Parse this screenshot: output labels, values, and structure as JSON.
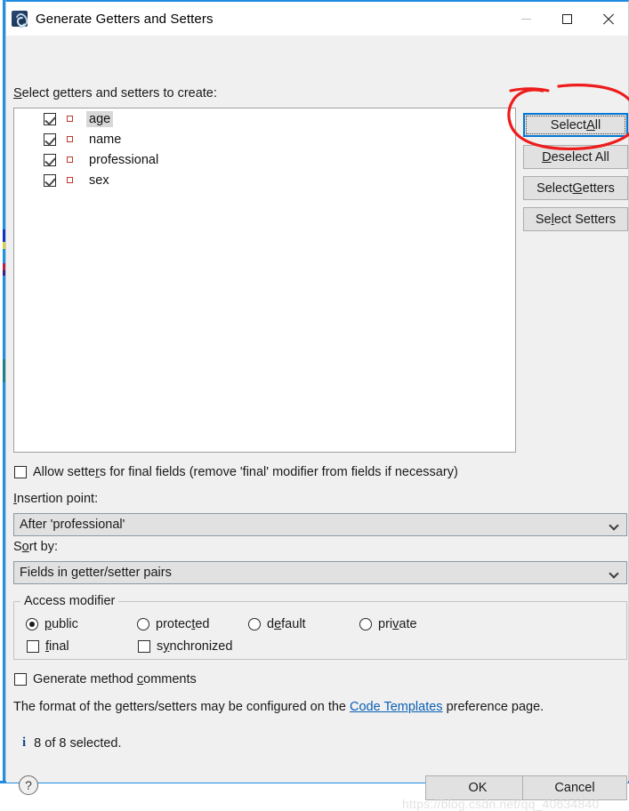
{
  "window": {
    "title": "Generate Getters and Setters",
    "icon": "eclipse-icon",
    "minimize_label": "—",
    "maximize_label": "□",
    "close_label": "✕"
  },
  "main": {
    "select_label_pre": "S",
    "select_label_post": "elect getters and setters to create:",
    "tree": {
      "items": [
        {
          "label": "age",
          "checked": true,
          "selected": true
        },
        {
          "label": "name",
          "checked": true,
          "selected": false
        },
        {
          "label": "professional",
          "checked": true,
          "selected": false
        },
        {
          "label": "sex",
          "checked": true,
          "selected": false
        }
      ]
    },
    "side_buttons": [
      {
        "pre": "Select ",
        "mnem": "A",
        "post": "ll",
        "focused": true
      },
      {
        "pre": "",
        "mnem": "D",
        "post": "eselect All",
        "focused": false
      },
      {
        "pre": "Select ",
        "mnem": "G",
        "post": "etters",
        "focused": false
      },
      {
        "pre": "Se",
        "mnem": "l",
        "post": "ect Setters",
        "focused": false
      }
    ],
    "allow_final": {
      "checked": false,
      "pre": "Allow sette",
      "mnem": "r",
      "post": "s for final fields (remove 'final' modifier from fields if necessary)"
    },
    "insertion": {
      "label_mnem": "I",
      "label_post": "nsertion point:",
      "value": "After 'professional'"
    },
    "sort": {
      "label_pre": "S",
      "label_mnem": "o",
      "label_post": "rt by:",
      "value": "Fields in getter/setter pairs"
    },
    "access_modifier": {
      "legend": "Access modifier",
      "radios": [
        {
          "pre": "",
          "mnem": "p",
          "post": "ublic",
          "selected": true
        },
        {
          "pre": "protec",
          "mnem": "t",
          "post": "ed",
          "selected": false
        },
        {
          "pre": "d",
          "mnem": "e",
          "post": "fault",
          "selected": false
        },
        {
          "pre": "pri",
          "mnem": "v",
          "post": "ate",
          "selected": false
        }
      ],
      "checkboxes": [
        {
          "pre": "",
          "mnem": "f",
          "post": "inal",
          "checked": false
        },
        {
          "pre": "s",
          "mnem": "y",
          "post": "nchronized",
          "checked": false
        }
      ]
    },
    "generate_comments": {
      "checked": false,
      "pre": "Generate method ",
      "mnem": "c",
      "post": "omments"
    },
    "format_line": {
      "pre": "The format of the getters/setters may be configured on the ",
      "link": "Code Templates",
      "post": " preference page."
    },
    "status": {
      "icon": "info-icon",
      "icon_glyph": "i",
      "text": "8 of 8 selected."
    }
  },
  "footer": {
    "help_label": "?",
    "ok_label": "OK",
    "cancel_label": "Cancel"
  },
  "annotation": {
    "type": "hand-drawn-red-ellipse",
    "color": "#ee1c1c",
    "target": "Select All"
  },
  "watermark": "https://blog.csdn.net/qq_40634840",
  "colors": {
    "accent": "#0078d7",
    "dialog_bg": "#f0f0f0",
    "link": "#0a5fb4",
    "field_icon": "#c0392b",
    "annotation": "#ee1c1c"
  }
}
